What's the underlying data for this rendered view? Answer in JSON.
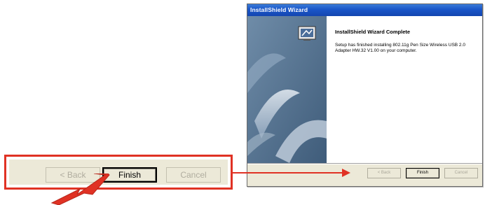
{
  "window": {
    "title": "InstallShield Wizard",
    "heading": "InstallShield Wizard Complete",
    "message": "Setup has finished installing 802.11g Pen Size Wireless USB 2.0 Adapter HW.32 V1.00 on your computer.",
    "buttons": {
      "back_label": "< Back",
      "finish_label": "Finish",
      "cancel_label": "Cancel"
    }
  },
  "callout": {
    "back_label": "< Back",
    "finish_label": "Finish",
    "cancel_label": "Cancel"
  },
  "colors": {
    "titlebar": "#1a56c8",
    "side_panel": "#4d6c8b",
    "dialog_bg": "#ece9d8",
    "highlight": "#e03224"
  },
  "icons": {
    "side_art": "installshield-wave-art",
    "setup_icon": "computer-setup-icon",
    "pointer": "red-arrow-pointer"
  }
}
